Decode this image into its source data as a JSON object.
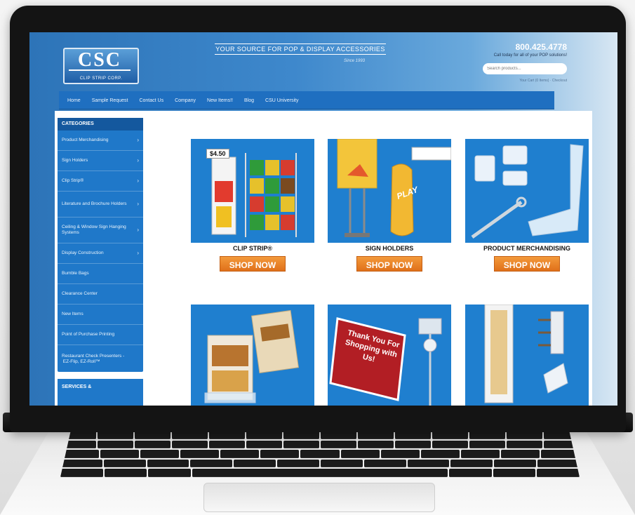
{
  "header": {
    "logo_text": "CSC",
    "logo_subtitle": "CLIP STRIP CORP.",
    "tagline": "YOUR SOURCE FOR POP & DISPLAY ACCESSORIES",
    "since": "Since 1993",
    "phone": "800.425.4778",
    "call_text": "Call today for all of your POP solutions!",
    "search_placeholder": "Search products...",
    "cart_text": "Your Cart (0 Items) · Checkout"
  },
  "nav": {
    "items": [
      "Home",
      "Sample Request",
      "Contact Us",
      "Company",
      "New Items!!",
      "Blog",
      "CSU University"
    ]
  },
  "sidebar": {
    "title": "CATEGORIES",
    "items": [
      {
        "label": "Product Merchandising"
      },
      {
        "label": "Sign Holders"
      },
      {
        "label": "Clip Strip®"
      },
      {
        "label": "Literature and Brochure Holders"
      },
      {
        "label": "Ceiling & Window Sign Hanging Systems"
      },
      {
        "label": "Display Construction"
      },
      {
        "label": "Bumble Bags"
      },
      {
        "label": "Clearance Center"
      },
      {
        "label": "New Items"
      },
      {
        "label": "Point of Purchase Printing"
      },
      {
        "label": "Restaurant Check Presenters -  EZ-Flip, EZ-Roll™"
      }
    ],
    "services_title": "SERVICES &"
  },
  "tiles": [
    {
      "title": "CLIP STRIP®",
      "button": "SHOP NOW",
      "price_tag": "$4.50"
    },
    {
      "title": "SIGN HOLDERS",
      "button": "SHOP NOW",
      "play_text": "PLAY"
    },
    {
      "title": "PRODUCT MERCHANDISING",
      "button": "SHOP NOW"
    },
    {
      "title": "",
      "button": ""
    },
    {
      "title": "",
      "button": "",
      "sign_text": "Thank You For Shopping with Us!"
    },
    {
      "title": "",
      "button": ""
    }
  ],
  "colors": {
    "brand_blue": "#1f78c9",
    "nav_blue": "#1f6fc0",
    "shop_orange": "#e0701a"
  }
}
